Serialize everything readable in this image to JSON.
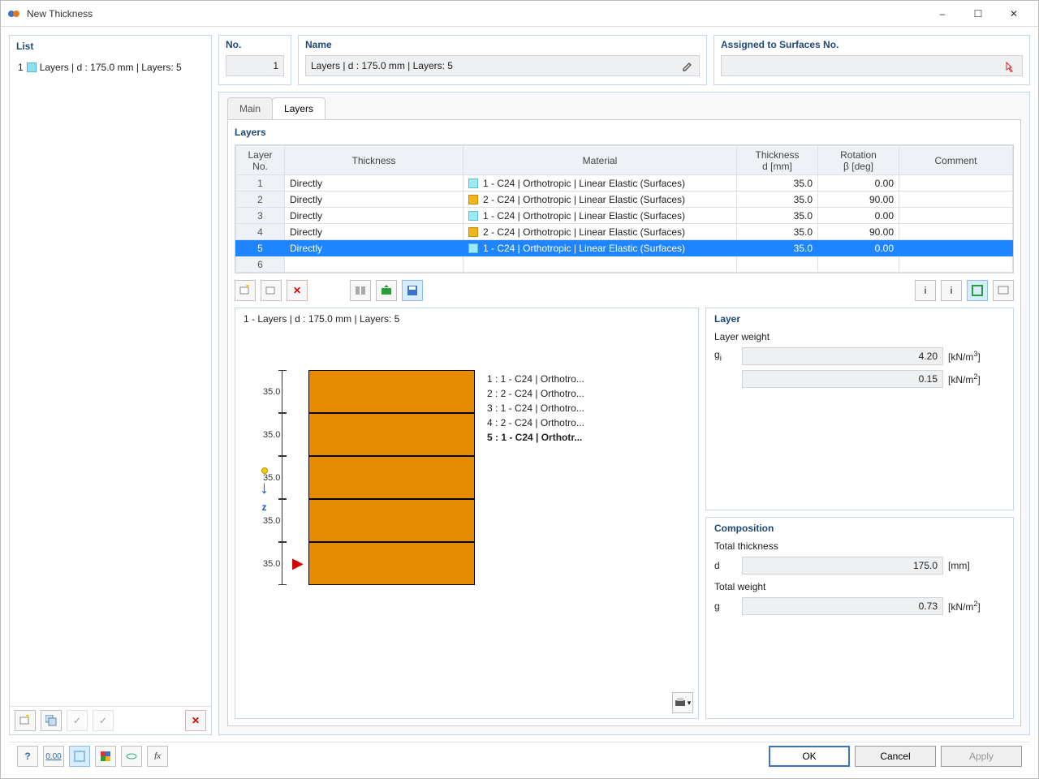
{
  "window": {
    "title": "New Thickness"
  },
  "left": {
    "head": "List",
    "items": [
      {
        "num": "1",
        "label": "Layers | d : 175.0 mm | Layers: 5"
      }
    ]
  },
  "top": {
    "no_lbl": "No.",
    "no_val": "1",
    "name_lbl": "Name",
    "name_val": "Layers | d : 175.0 mm | Layers: 5",
    "assign_lbl": "Assigned to Surfaces No.",
    "assign_val": ""
  },
  "tabs": {
    "main": "Main",
    "layers": "Layers"
  },
  "layers": {
    "title": "Layers",
    "headers": {
      "layer_no": "Layer\nNo.",
      "thickness": "Thickness",
      "material": "Material",
      "thick_d": "Thickness\nd [mm]",
      "rot": "Rotation\nβ [deg]",
      "comment": "Comment"
    },
    "rows": [
      {
        "n": "1",
        "th": "Directly",
        "mat": "1 - C24 | Orthotropic | Linear Elastic (Surfaces)",
        "sw": "c1",
        "d": "35.0",
        "b": "0.00",
        "c": ""
      },
      {
        "n": "2",
        "th": "Directly",
        "mat": "2 - C24 | Orthotropic | Linear Elastic (Surfaces)",
        "sw": "c2",
        "d": "35.0",
        "b": "90.00",
        "c": ""
      },
      {
        "n": "3",
        "th": "Directly",
        "mat": "1 - C24 | Orthotropic | Linear Elastic (Surfaces)",
        "sw": "c1",
        "d": "35.0",
        "b": "0.00",
        "c": ""
      },
      {
        "n": "4",
        "th": "Directly",
        "mat": "2 - C24 | Orthotropic | Linear Elastic (Surfaces)",
        "sw": "c2",
        "d": "35.0",
        "b": "90.00",
        "c": ""
      },
      {
        "n": "5",
        "th": "Directly",
        "mat": "1 - C24 | Orthotropic | Linear Elastic (Surfaces)",
        "sw": "c1",
        "d": "35.0",
        "b": "0.00",
        "c": "",
        "sel": true
      },
      {
        "n": "6",
        "th": "",
        "mat": "",
        "sw": "",
        "d": "",
        "b": "",
        "c": ""
      }
    ]
  },
  "preview": {
    "title": "1 - Layers | d : 175.0 mm | Layers: 5",
    "dims": [
      "35.0",
      "35.0",
      "35.0",
      "35.0",
      "35.0"
    ],
    "axis": "z",
    "legend": [
      "1 : 1 - C24 | Orthotro...",
      "2 : 2 - C24 | Orthotro...",
      "3 : 1 - C24 | Orthotro...",
      "4 : 2 - C24 | Orthotro...",
      "5 : 1 - C24 | Orthotr..."
    ]
  },
  "layer_panel": {
    "title": "Layer",
    "weight_lbl": "Layer weight",
    "gi_sym": "gᵢ",
    "gi_val": "4.20",
    "gi_unit": "[kN/m³]",
    "gi2_val": "0.15",
    "gi2_unit": "[kN/m²]"
  },
  "comp_panel": {
    "title": "Composition",
    "tt_lbl": "Total thickness",
    "d_sym": "d",
    "d_val": "175.0",
    "d_unit": "[mm]",
    "tw_lbl": "Total weight",
    "g_sym": "g",
    "g_val": "0.73",
    "g_unit": "[kN/m²]"
  },
  "buttons": {
    "ok": "OK",
    "cancel": "Cancel",
    "apply": "Apply"
  }
}
